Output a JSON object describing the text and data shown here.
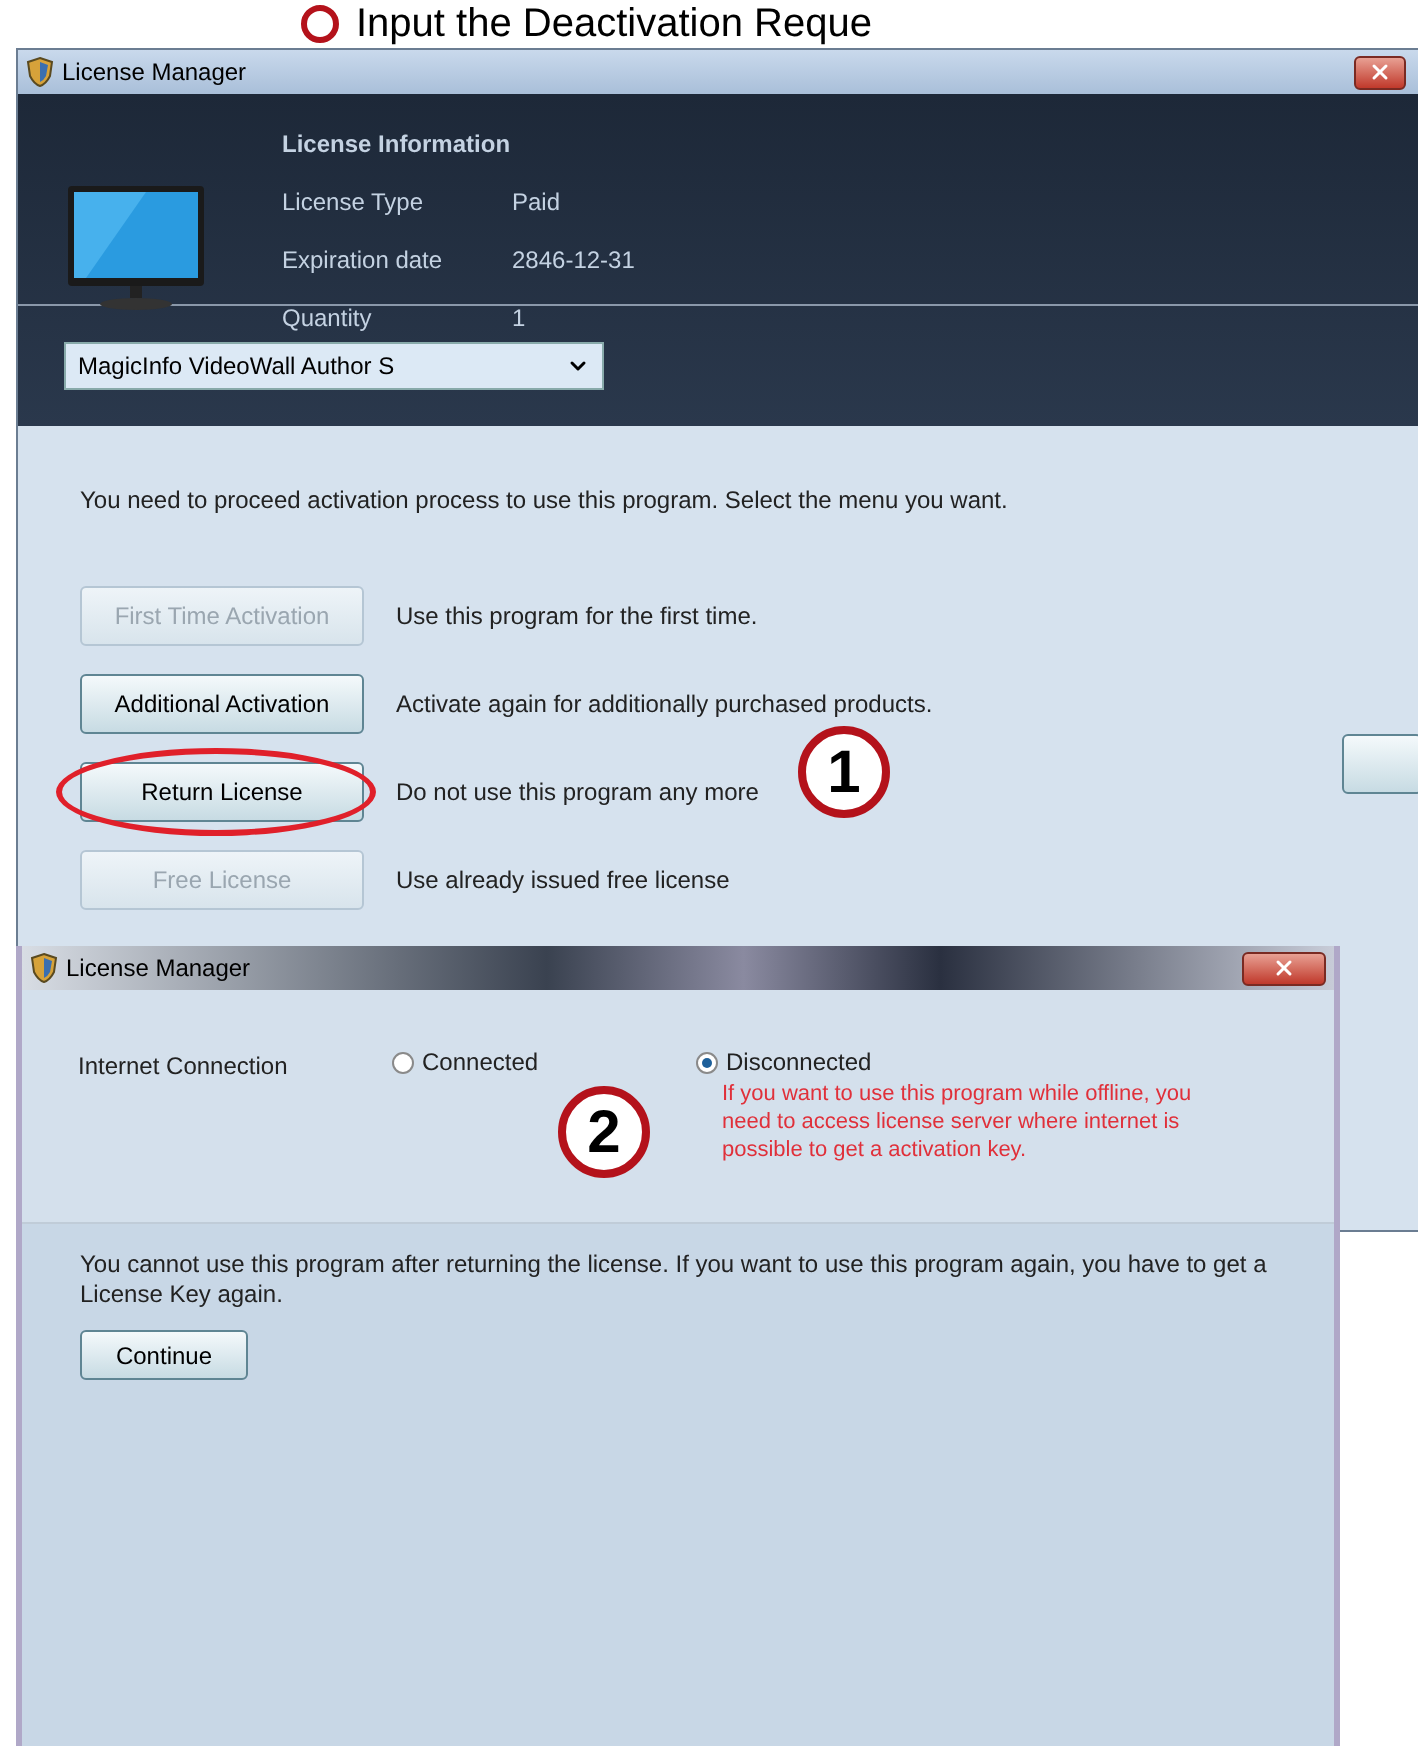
{
  "annotation": {
    "text": "Input the Deactivation Reque"
  },
  "main_window": {
    "title": "License Manager",
    "license_info": {
      "heading": "License Information",
      "rows": [
        {
          "label": "License Type",
          "value": "Paid"
        },
        {
          "label": "Expiration date",
          "value": "2846-12-31"
        },
        {
          "label": "Quantity",
          "value": "1"
        }
      ]
    },
    "product_dropdown": {
      "value": "MagicInfo VideoWall Author S"
    },
    "instruction": "You need to proceed activation process to use this program. Select the menu you want.",
    "options": [
      {
        "button": "First Time Activation",
        "description": "Use this program for the first time.",
        "disabled": true,
        "highlighted": false
      },
      {
        "button": "Additional Activation",
        "description": "Activate again for additionally purchased products.",
        "disabled": false,
        "highlighted": false
      },
      {
        "button": "Return License",
        "description": "Do not use this program any more",
        "disabled": false,
        "highlighted": true
      },
      {
        "button": "Free License",
        "description": "Use already issued free license",
        "disabled": true,
        "highlighted": false
      }
    ],
    "callout": "1"
  },
  "return_window": {
    "title": "License Manager",
    "connection_label": "Internet Connection",
    "radios": [
      {
        "label": "Connected",
        "selected": false
      },
      {
        "label": "Disconnected",
        "selected": true
      }
    ],
    "offline_note": "If you want to use this program while offline, you need to access license server where internet is possible to get a activation key.",
    "callout": "2",
    "warning": "You cannot use this program after returning the license. If you want to use this program again, you have to get a License Key again.",
    "continue_button": "Continue"
  }
}
